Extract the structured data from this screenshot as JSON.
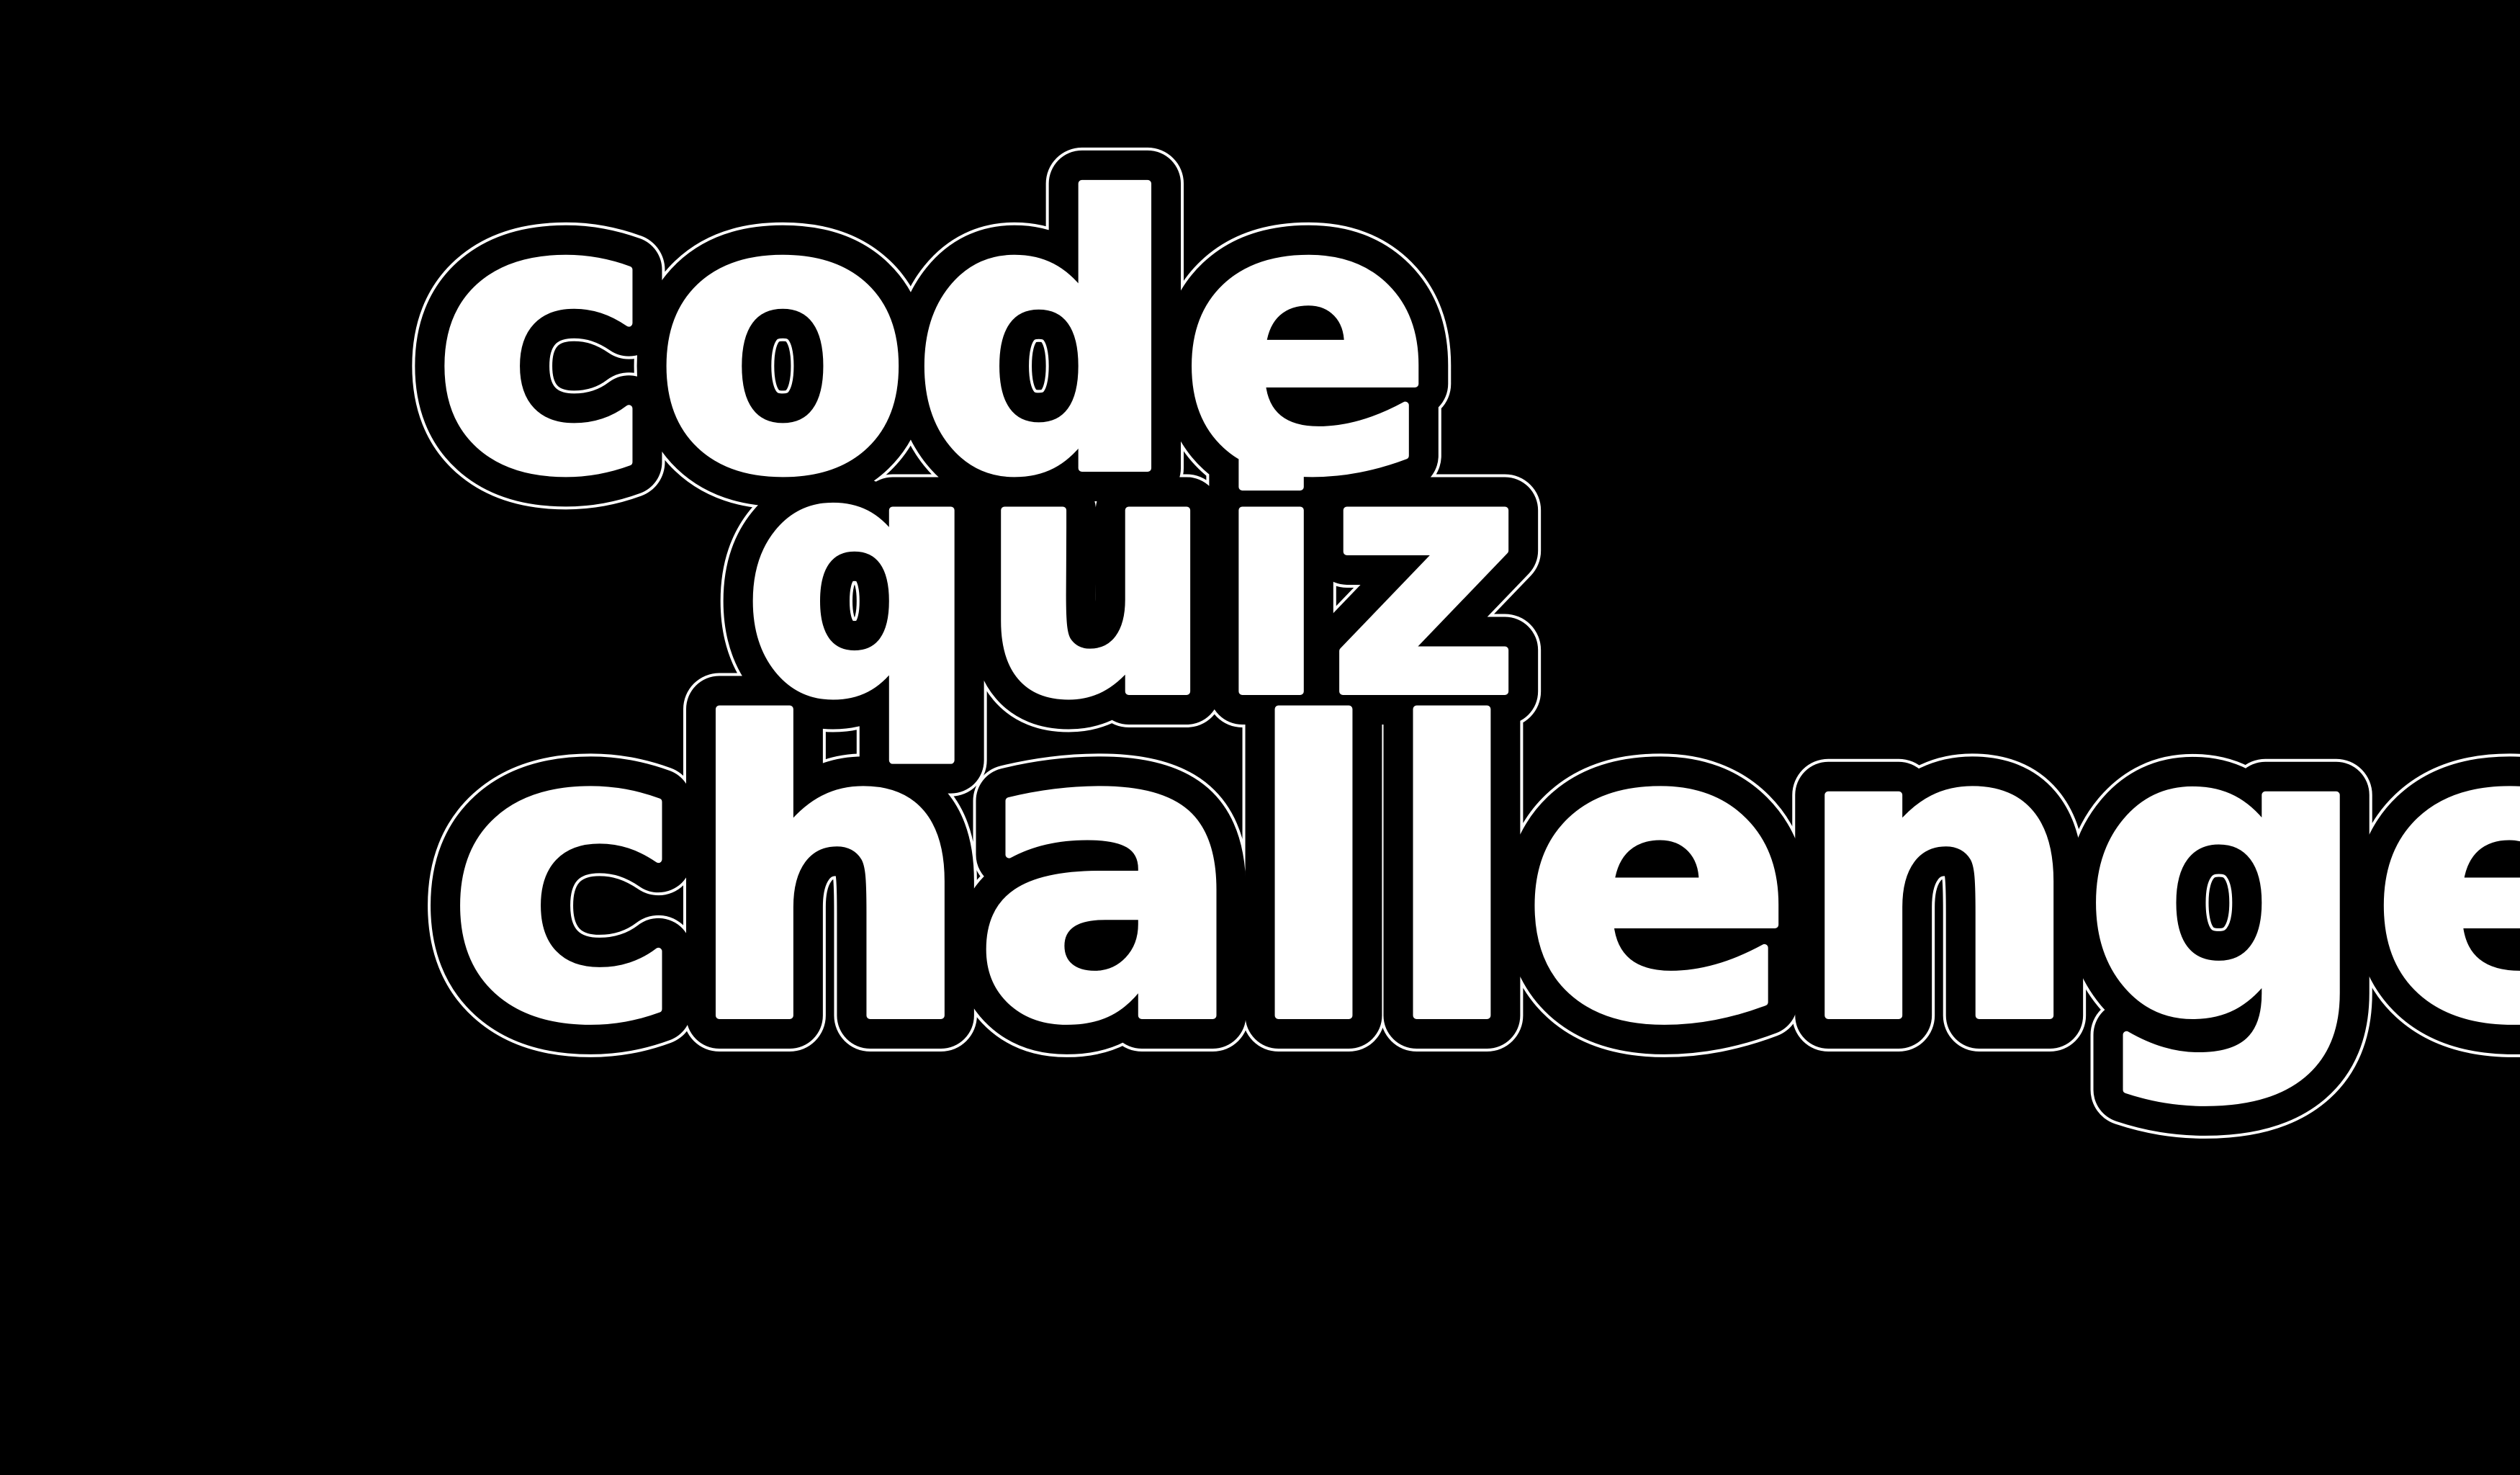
{
  "logo": {
    "line1": "code",
    "line2": "quiz",
    "line3": "challenge"
  },
  "colors": {
    "background": "#000000",
    "lettering": "#ffffff",
    "outline": "#ffffff"
  }
}
